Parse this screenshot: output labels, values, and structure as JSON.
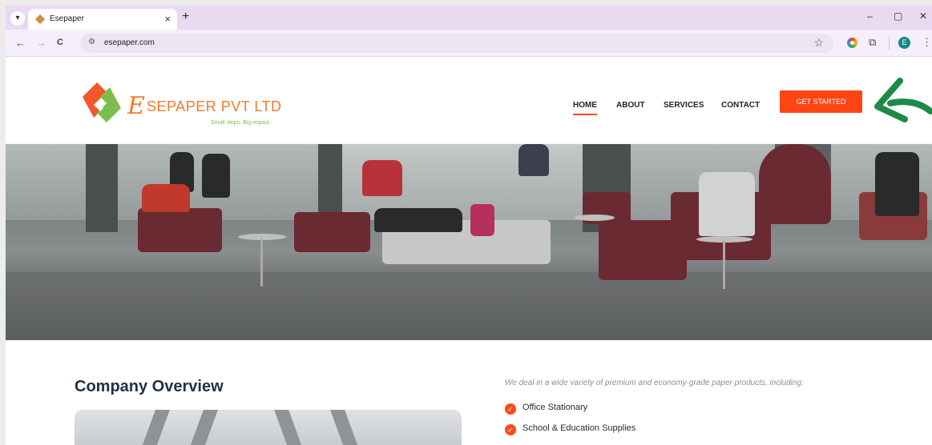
{
  "browser": {
    "tab_title": "Esepaper",
    "tab_close": "×",
    "new_tab": "+",
    "url": "esepaper.com",
    "profile_initial": "E",
    "tab_dropdown": "▾",
    "window_controls": {
      "minimize": "–",
      "restore": "▢",
      "close": "✕"
    },
    "nav_icons": {
      "back": "←",
      "forward": "→",
      "reload": "C"
    },
    "site_info_icon": "⚙",
    "bookmark_icon": "☆",
    "extensions_icon": "⧉",
    "menu_icon": "⋮"
  },
  "site": {
    "logo": {
      "initial": "E",
      "name": "SEPAPER PVT LTD",
      "tagline": "Small steps. Big impact."
    },
    "nav": [
      {
        "label": "HOME",
        "active": true
      },
      {
        "label": "ABOUT",
        "active": false
      },
      {
        "label": "SERVICES",
        "active": false
      },
      {
        "label": "CONTACT",
        "active": false
      }
    ],
    "cta_label": "GET STARTED",
    "colors": {
      "accent": "#ff4413",
      "logo_orange": "#f27a2b",
      "logo_green": "#7dbd4e",
      "heading": "#1f3148",
      "arrow_green": "#1e8a4a"
    }
  },
  "content": {
    "overview_title": "Company Overview",
    "intro": "We deal in a wide variety of premium and economy-grade paper products, including:",
    "products": [
      "Office Stationary",
      "School & Education Supplies"
    ]
  }
}
